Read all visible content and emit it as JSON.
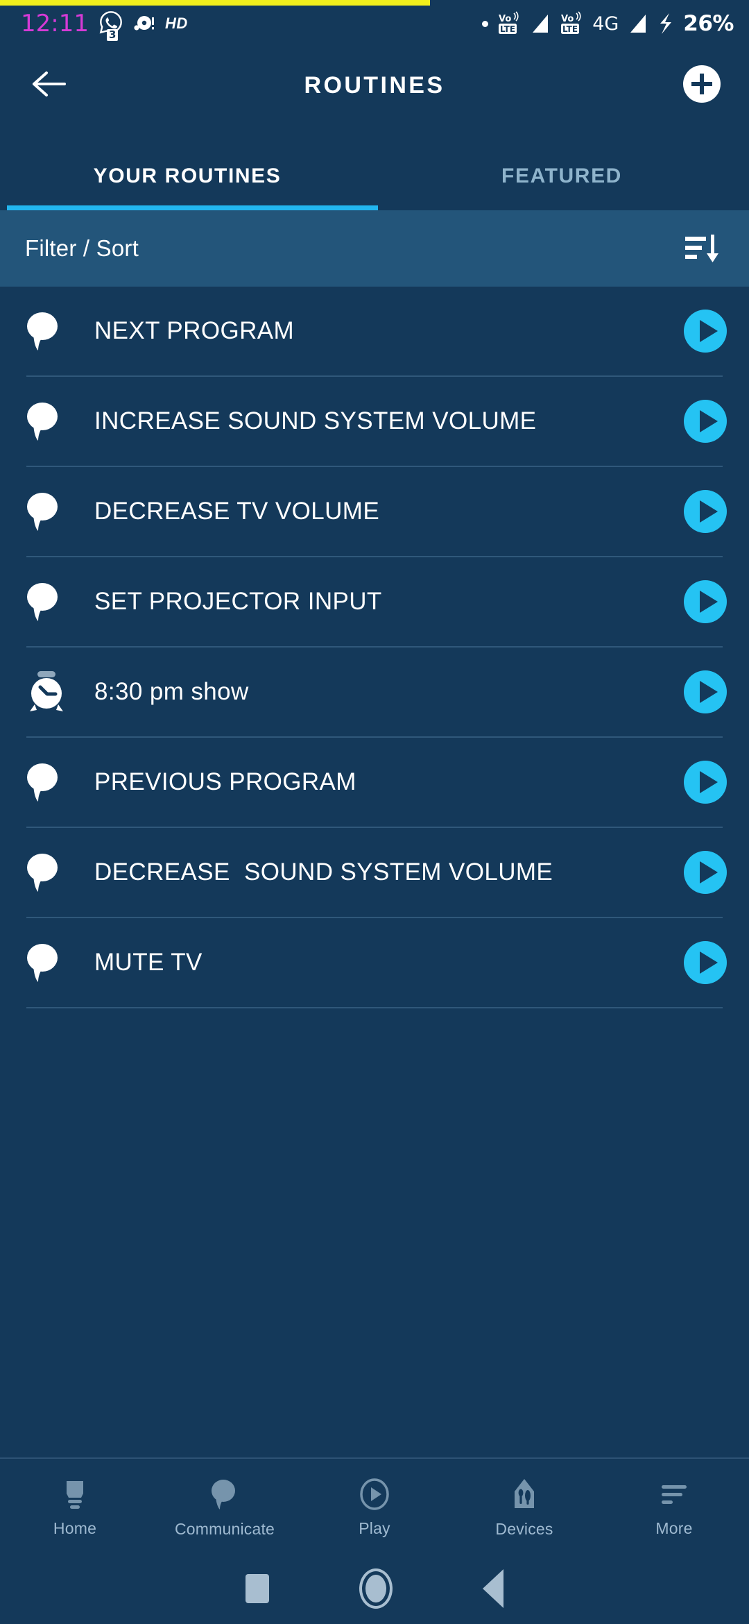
{
  "colors": {
    "background": "#14395a",
    "filter_bar": "#23557a",
    "accent_cyan": "#22b6ef",
    "play_button": "#25c3f3",
    "tab_inactive": "#8fb4cc",
    "divider": "#30587a",
    "nav_label": "#9fbad1",
    "clock": "#d63ad6",
    "progress_sliver": "#f2ef1b"
  },
  "statusbar": {
    "time": "12:11",
    "whatsapp_badge": "3",
    "hd_label": "HD",
    "network_label": "4G",
    "battery": "26%",
    "icons": [
      "whatsapp-icon",
      "screen-record-icon",
      "hd-icon",
      "dot-icon",
      "volte-icon",
      "signal-icon",
      "volte-icon-2",
      "signal-icon-2",
      "charging-bolt-icon"
    ]
  },
  "header": {
    "title": "ROUTINES",
    "back_icon": "back-arrow-icon",
    "add_icon": "plus-icon"
  },
  "tabs": [
    {
      "label": "YOUR ROUTINES",
      "active": true
    },
    {
      "label": "FEATURED",
      "active": false
    }
  ],
  "filter": {
    "label": "Filter / Sort",
    "sort_icon": "sort-descending-icon"
  },
  "routines": [
    {
      "label": "NEXT PROGRAM",
      "icon": "speech-bubble-icon",
      "play_icon": "play-icon"
    },
    {
      "label": "INCREASE SOUND SYSTEM VOLUME",
      "icon": "speech-bubble-icon",
      "play_icon": "play-icon"
    },
    {
      "label": "DECREASE TV VOLUME",
      "icon": "speech-bubble-icon",
      "play_icon": "play-icon"
    },
    {
      "label": "SET PROJECTOR INPUT",
      "icon": "speech-bubble-icon",
      "play_icon": "play-icon"
    },
    {
      "label": "8:30 pm show",
      "icon": "alarm-clock-icon",
      "play_icon": "play-icon"
    },
    {
      "label": "PREVIOUS PROGRAM",
      "icon": "speech-bubble-icon",
      "play_icon": "play-icon"
    },
    {
      "label": "DECREASE  SOUND SYSTEM VOLUME",
      "icon": "speech-bubble-icon",
      "play_icon": "play-icon"
    },
    {
      "label": "MUTE TV",
      "icon": "speech-bubble-icon",
      "play_icon": "play-icon"
    }
  ],
  "bottom_nav": [
    {
      "label": "Home",
      "icon": "echo-device-icon"
    },
    {
      "label": "Communicate",
      "icon": "speech-bubble-icon"
    },
    {
      "label": "Play",
      "icon": "play-circle-icon"
    },
    {
      "label": "Devices",
      "icon": "devices-icon"
    },
    {
      "label": "More",
      "icon": "hamburger-more-icon"
    }
  ],
  "android_nav": {
    "recents": "square-recents-icon",
    "home": "circle-home-icon",
    "back": "triangle-back-icon"
  }
}
